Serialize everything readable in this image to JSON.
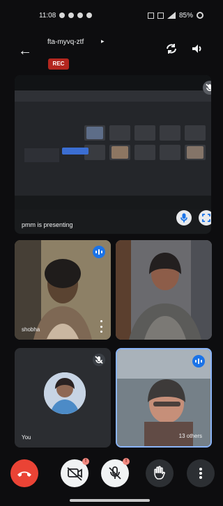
{
  "status_bar": {
    "time": "11:08",
    "battery": "85%"
  },
  "header": {
    "meeting_code": "fta-myvq-ztf",
    "rec_label": "REC",
    "icons": {
      "back": "back-arrow-icon",
      "camera_switch": "camera-switch-icon",
      "audio": "speaker-icon"
    }
  },
  "presentation": {
    "presenting_text": "pmm is presenting",
    "icons": {
      "top_mic": "mic-muted-icon",
      "mic": "mic-icon",
      "expand": "expand-icon"
    }
  },
  "participants": [
    {
      "name": "shobha",
      "status": "speaking"
    },
    {
      "name": "",
      "status": "video"
    },
    {
      "name": "You",
      "status": "muted"
    },
    {
      "name": "13 others",
      "status": "speaking"
    }
  ],
  "controls": {
    "camera_badge": "!",
    "mic_badge": "!",
    "icons": [
      "end-call-icon",
      "camera-off-icon",
      "mic-off-icon",
      "raise-hand-icon",
      "more-vertical-icon"
    ]
  },
  "colors": {
    "accent": "#1a73e8",
    "end_call": "#ea4335",
    "recording": "#b3261e",
    "badge": "#f28b82"
  }
}
